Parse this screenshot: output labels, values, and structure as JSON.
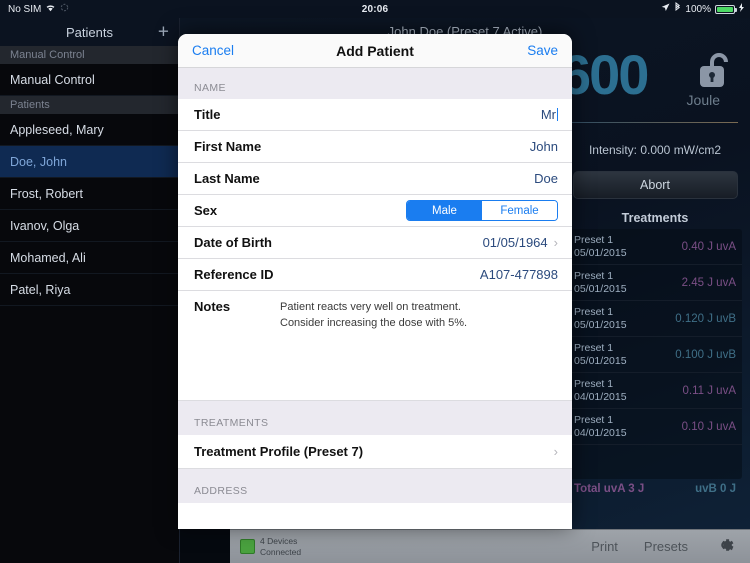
{
  "status_bar": {
    "carrier": "No SIM",
    "wifi_icon": "wifi-icon",
    "sync_icon": "sync-icon",
    "time": "20:06",
    "location_icon": "location-arrow-icon",
    "bluetooth_icon": "bluetooth-icon",
    "battery_percent": "100%",
    "charging_icon": "charging-bolt-icon"
  },
  "sidebar": {
    "title": "Patients",
    "add_label": "+",
    "groups": [
      {
        "header": "Manual Control",
        "items": [
          {
            "label": "Manual Control",
            "selected": false
          }
        ]
      },
      {
        "header": "Patients",
        "items": [
          {
            "label": "Appleseed, Mary",
            "selected": false
          },
          {
            "label": "Doe, John",
            "selected": true
          },
          {
            "label": "Frost, Robert",
            "selected": false
          },
          {
            "label": "Ivanov, Olga",
            "selected": false
          },
          {
            "label": "Mohamed, Ali",
            "selected": false
          },
          {
            "label": "Patel, Riya",
            "selected": false
          }
        ]
      }
    ]
  },
  "main": {
    "title": "John Doe (Preset 7 Active)",
    "dose_value": "600",
    "dose_unit": "Joule",
    "lock_icon": "unlocked-padlock-icon",
    "intensity": "Intensity: 0.000 mW/cm2",
    "abort_label": "Abort",
    "treatments_title": "Treatments",
    "treatments": [
      {
        "preset": "Preset 1",
        "date": "05/01/2015",
        "value": "0.40 J uvA",
        "type": "uva"
      },
      {
        "preset": "Preset 1",
        "date": "05/01/2015",
        "value": "2.45 J uvA",
        "type": "uva"
      },
      {
        "preset": "Preset 1",
        "date": "05/01/2015",
        "value": "0.120 J uvB",
        "type": "uvb"
      },
      {
        "preset": "Preset 1",
        "date": "05/01/2015",
        "value": "0.100 J uvB",
        "type": "uvb"
      },
      {
        "preset": "Preset 1",
        "date": "04/01/2015",
        "value": "0.11 J uvA",
        "type": "uva"
      },
      {
        "preset": "Preset 1",
        "date": "04/01/2015",
        "value": "0.10 J uvA",
        "type": "uva"
      }
    ],
    "total_uva": "Total uvA 3 J",
    "total_uvb": "uvB 0 J"
  },
  "toolbar": {
    "devices_line1": "4 Devices",
    "devices_line2": "Connected",
    "print_label": "Print",
    "presets_label": "Presets",
    "gear_icon": "gear-icon"
  },
  "modal": {
    "cancel_label": "Cancel",
    "title": "Add Patient",
    "save_label": "Save",
    "section_name": "NAME",
    "fields": {
      "title_label": "Title",
      "title_value": "Mr",
      "first_name_label": "First Name",
      "first_name_value": "John",
      "last_name_label": "Last Name",
      "last_name_value": "Doe",
      "sex_label": "Sex",
      "sex_male": "Male",
      "sex_female": "Female",
      "dob_label": "Date of Birth",
      "dob_value": "01/05/1964",
      "ref_label": "Reference ID",
      "ref_value": "A107-477898",
      "notes_label": "Notes",
      "notes_line1": "Patient reacts very well on treatment.",
      "notes_line2": "Consider increasing the dose with 5%."
    },
    "section_treatments": "TREATMENTS",
    "treatment_profile_label": "Treatment Profile (Preset 7)",
    "section_address": "ADDRESS"
  },
  "colors": {
    "accent": "#1a7df0",
    "selected_row": "#0f2a52",
    "battery": "#4cd964"
  }
}
